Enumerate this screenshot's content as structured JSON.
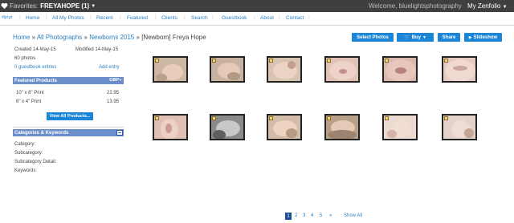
{
  "topbar": {
    "favorites_label": "Favorites:",
    "favorites_name": "FREYAHOPE (1)",
    "welcome": "Welcome, bluelightsphotography",
    "my_zenfolio": "My Zenfolio"
  },
  "nav": {
    "logo": "#lpl.pt",
    "items": [
      "Home",
      "All My Photos",
      "Recent",
      "Featured",
      "Clients",
      "Search",
      "Guestbook",
      "About",
      "Contact"
    ]
  },
  "breadcrumb": {
    "home": "Home",
    "sep": "»",
    "all_photos": "All Photographs",
    "newborns": "Newborns 2015",
    "current": "[Newborn] Freya Hope"
  },
  "actions": {
    "select_photos": "Select Photos",
    "buy": "Buy",
    "share": "Share",
    "slideshow": "Slideshow"
  },
  "gallery_info": {
    "created": "Created 14-May-15",
    "modified": "Modified 14-May-15",
    "photo_count": "60 photos",
    "guestbook_entries": "0 guestbook entries",
    "add_entry": "Add entry"
  },
  "featured_products": {
    "title": "Featured Products",
    "currency": "GBP",
    "items": [
      {
        "name": "10\" x 8\" Print",
        "price": "22.95"
      },
      {
        "name": "6\" x 4\" Print",
        "price": "13.95"
      }
    ],
    "view_all": "View All Products..."
  },
  "categories": {
    "title": "Categories & Keywords",
    "fields": [
      "Category:",
      "Subcategory:",
      "Subcategory Detail:",
      "Keywords:"
    ]
  },
  "pagination": {
    "pages": [
      "1",
      "2",
      "3",
      "4",
      "5"
    ],
    "next": "»",
    "show_all": "Show All"
  },
  "colors": {
    "accent": "#1b86d8",
    "topbar": "#3f3f3f",
    "panel_header": "#6b8ec8",
    "link": "#2a7fc1"
  }
}
